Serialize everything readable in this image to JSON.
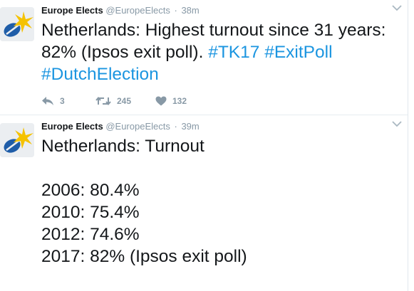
{
  "tweets": [
    {
      "display_name": "Europe Elects",
      "handle": "@EuropeElects",
      "separator": "·",
      "time": "38m",
      "text_plain": "Netherlands: Highest turnout since 31 years: 82% (Ipsos exit poll). ",
      "hashtags": [
        "#TK17",
        "#ExitPoll",
        "#DutchElection"
      ],
      "reply_count": "3",
      "retweet_count": "245",
      "like_count": "132"
    },
    {
      "display_name": "Europe Elects",
      "handle": "@EuropeElects",
      "separator": "·",
      "time": "39m",
      "text": "Netherlands: Turnout\n\n2006: 80.4%\n2010: 75.4%\n2012: 74.6%\n2017: 82% (Ipsos exit poll)"
    }
  ],
  "icons": {
    "reply": "reply-icon",
    "retweet": "retweet-icon",
    "like": "heart-icon",
    "caret": "chevron-down-icon",
    "avatar": "europe-elects-logo"
  },
  "colors": {
    "hashtag": "#1b95e0",
    "text": "#14171a",
    "muted": "#8899a6",
    "logo_yellow": "#f5c200",
    "logo_blue": "#1f5da8"
  }
}
